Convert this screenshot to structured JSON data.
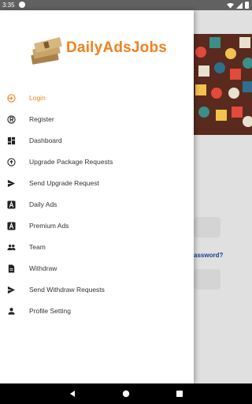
{
  "status_bar": {
    "time": "3:35"
  },
  "app": {
    "name": "DailyAdsJobs",
    "accent_color": "#f0821e"
  },
  "menu": {
    "items": [
      {
        "label": "Login",
        "icon": "login-icon",
        "active": true
      },
      {
        "label": "Register",
        "icon": "registered-icon"
      },
      {
        "label": "Dashboard",
        "icon": "dashboard-icon"
      },
      {
        "label": "Upgrade Package Requests",
        "icon": "upgrade-icon"
      },
      {
        "label": "Send Upgrade Request",
        "icon": "send-icon"
      },
      {
        "label": "Daily Ads",
        "icon": "ads-icon"
      },
      {
        "label": "Premium Ads",
        "icon": "ads-icon"
      },
      {
        "label": "Team",
        "icon": "team-icon"
      },
      {
        "label": "Withdraw",
        "icon": "document-icon"
      },
      {
        "label": "Send Withdraw Requests",
        "icon": "send-icon"
      },
      {
        "label": "Profile Setting",
        "icon": "person-icon"
      }
    ]
  },
  "background": {
    "forgot_password_fragment": "assword?"
  }
}
